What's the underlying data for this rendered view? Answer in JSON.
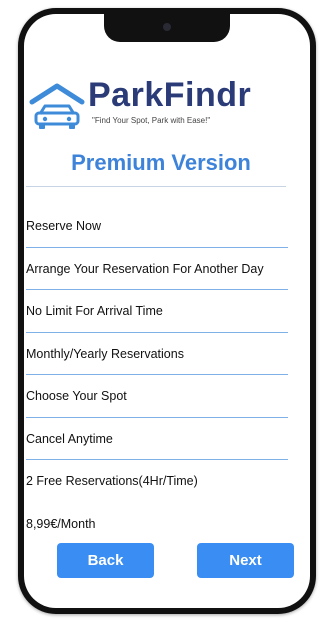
{
  "app": {
    "brand": "ParkFindr",
    "tagline": "\"Find Your Spot, Park with Ease!\""
  },
  "title": "Premium Version",
  "features": [
    "Reserve Now",
    "Arrange Your Reservation For Another Day",
    "No Limit For Arrival Time",
    "Monthly/Yearly Reservations",
    "Choose Your Spot",
    "Cancel Anytime",
    "2 Free Reservations(4Hr/Time)"
  ],
  "price": "8,99€/Month",
  "buttons": {
    "back": "Back",
    "next": "Next"
  },
  "icons": {
    "logo": "parking-garage-car-icon"
  },
  "colors": {
    "brand": "#2b3b78",
    "accent": "#3a8df2",
    "title": "#3d83d9"
  }
}
